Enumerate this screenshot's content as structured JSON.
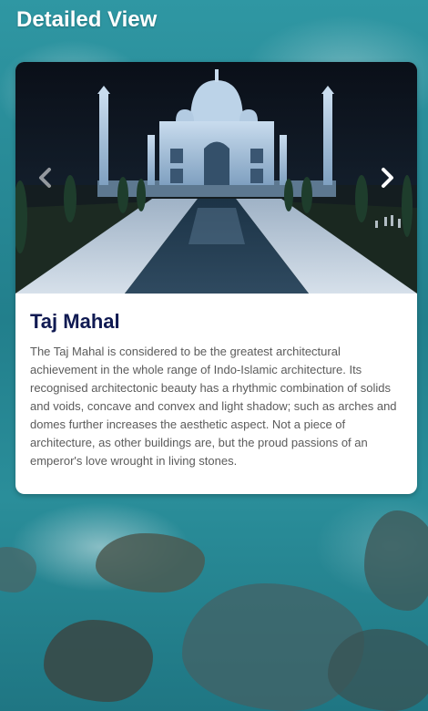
{
  "page": {
    "title": "Detailed View"
  },
  "detail": {
    "title": "Taj Mahal",
    "description": "The Taj Mahal is considered to be the greatest architectural achievement in the whole range of Indo-Islamic architecture. Its recognised architectonic beauty has a rhythmic combination of solids and voids, concave and convex and light shadow; such as arches and domes further increases the aesthetic aspect. Not a piece of architecture, as other buildings are, but the proud passions of an emperor's love wrought in living stones."
  },
  "carousel": {
    "prev_icon": "chevron-left-icon",
    "next_icon": "chevron-right-icon"
  },
  "colors": {
    "title": "#101a52",
    "description": "#5b5b5b",
    "background_water": "#2a8e9a",
    "card": "#ffffff"
  }
}
